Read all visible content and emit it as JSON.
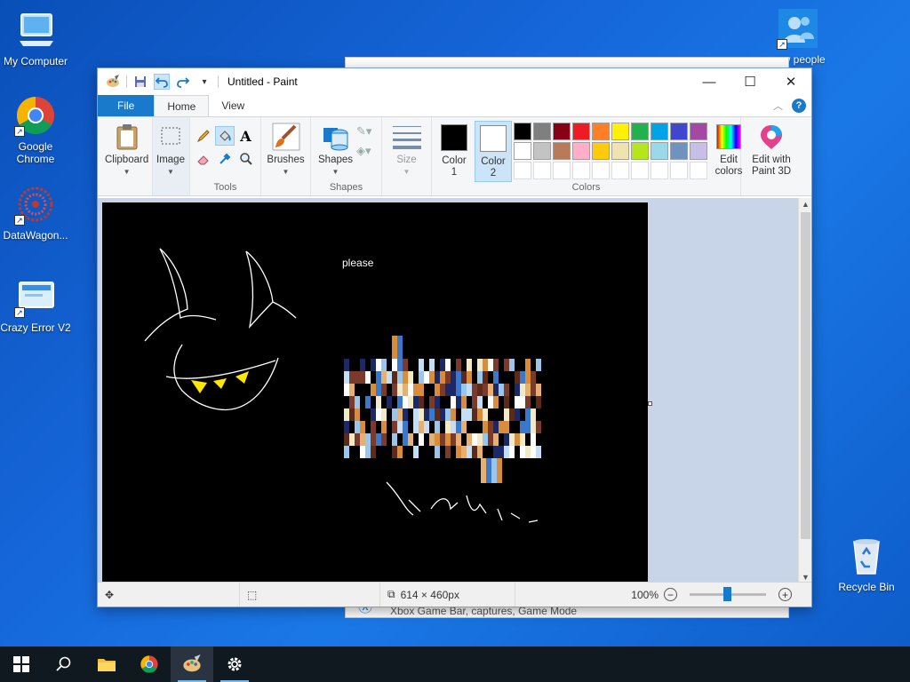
{
  "desktop": {
    "icons": [
      {
        "label": "My Computer"
      },
      {
        "label": "Google Chrome"
      },
      {
        "label": "DataWagon..."
      },
      {
        "label": "Crazy Error V2"
      },
      {
        "label": "..ow people"
      },
      {
        "label": "Recycle Bin"
      }
    ]
  },
  "background_window": {
    "caption": "Xbox Game Bar, captures, Game Mode"
  },
  "paint": {
    "title": "Untitled - Paint",
    "tabs": {
      "file": "File",
      "home": "Home",
      "view": "View"
    },
    "ribbon": {
      "clipboard": "Clipboard",
      "image": "Image",
      "tools_label": "Tools",
      "brushes": "Brushes",
      "shapes": "Shapes",
      "shapes_label": "Shapes",
      "size": "Size",
      "color1": "Color 1",
      "color2": "Color 2",
      "colors_label": "Colors",
      "edit_colors": "Edit colors",
      "edit_paint3d": "Edit with Paint 3D"
    },
    "palette": {
      "row1": [
        "#000000",
        "#7f7f7f",
        "#880015",
        "#ed1c24",
        "#ff7f27",
        "#fff200",
        "#22b14c",
        "#00a2e8",
        "#3f48cc",
        "#a349a4"
      ],
      "row2": [
        "#ffffff",
        "#c3c3c3",
        "#b97a57",
        "#ffaec9",
        "#ffc90e",
        "#efe4b0",
        "#b5e61d",
        "#99d9ea",
        "#7092be",
        "#c8bfe7"
      ]
    },
    "color1_value": "#000000",
    "color2_value": "#ffffff",
    "canvas_text": "please",
    "status": {
      "canvas_size": "614 × 460px",
      "zoom": "100%"
    }
  }
}
